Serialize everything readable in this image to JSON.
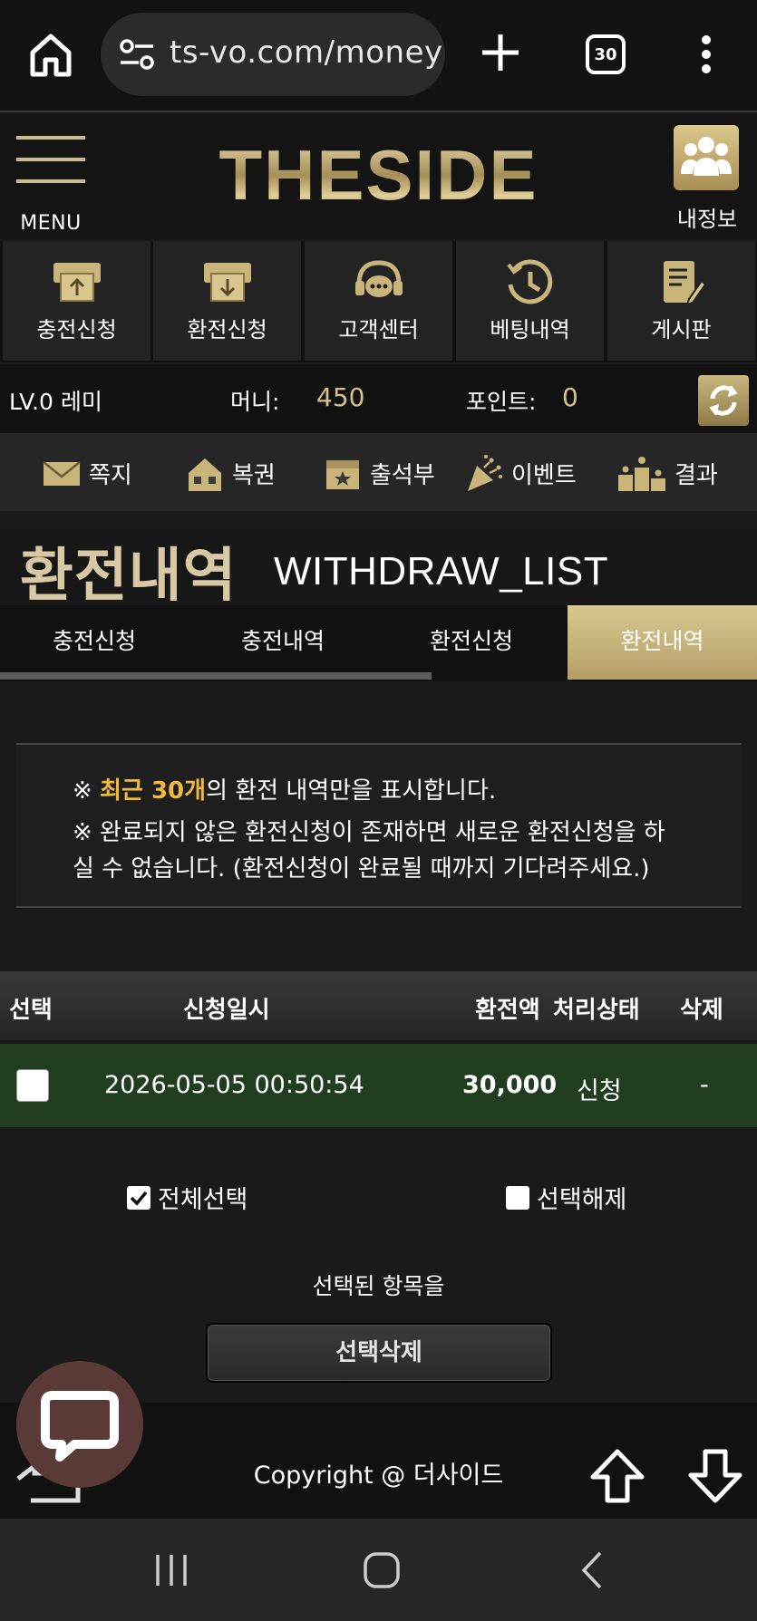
{
  "browser": {
    "url": "ts-vo.com/money",
    "tab_count": "30"
  },
  "header": {
    "logo": "THESIDE",
    "menu_label": "MENU",
    "myinfo_label": "내정보"
  },
  "quick_nav": [
    {
      "label": "충전신청",
      "icon": "deposit-icon"
    },
    {
      "label": "환전신청",
      "icon": "withdraw-icon"
    },
    {
      "label": "고객센터",
      "icon": "headset-chat-icon"
    },
    {
      "label": "베팅내역",
      "icon": "history-clock-icon"
    },
    {
      "label": "게시판",
      "icon": "board-edit-icon"
    }
  ],
  "info": {
    "level": "LV.0 레미",
    "money_label": "머니:",
    "money_value": "450",
    "point_label": "포인트:",
    "point_value": "0"
  },
  "sub_nav": [
    {
      "label": "쪽지",
      "icon": "envelope-icon"
    },
    {
      "label": "복권",
      "icon": "lottery-icon"
    },
    {
      "label": "출석부",
      "icon": "calendar-star-icon"
    },
    {
      "label": "이벤트",
      "icon": "party-popper-icon"
    },
    {
      "label": "결과",
      "icon": "podium-icon"
    }
  ],
  "page": {
    "title_ko": "환전내역",
    "title_en": "WITHDRAW_LIST"
  },
  "tabs": [
    "충전신청",
    "충전내역",
    "환전신청",
    "환전내역"
  ],
  "active_tab": 3,
  "notice": {
    "line1_prefix": "※ ",
    "line1_highlight": "최근 30개",
    "line1_suffix": "의 환전 내역만을 표시합니다.",
    "line2": "※ 완료되지 않은 환전신청이 존재하면 새로운 환전신청을 하",
    "line3": "실 수 없습니다. (환전신청이 완료될 때까지 기다려주세요.)"
  },
  "table": {
    "headers": [
      "선택",
      "신청일시",
      "환전액",
      "처리상태",
      "삭제"
    ],
    "rows": [
      {
        "datetime": "2026-05-05 00:50:54",
        "amount": "30,000",
        "status": "신청",
        "delete": "-"
      }
    ]
  },
  "controls": {
    "select_all": "전체선택",
    "deselect": "선택해제",
    "caption": "선택된 항목을",
    "delete_button": "선택삭제"
  },
  "footer": {
    "copyright": "Copyright @ 더사이드"
  },
  "colors": {
    "gold": "#d5c08a",
    "highlight": "#f0b93a",
    "row_bg": "#203d1f"
  }
}
